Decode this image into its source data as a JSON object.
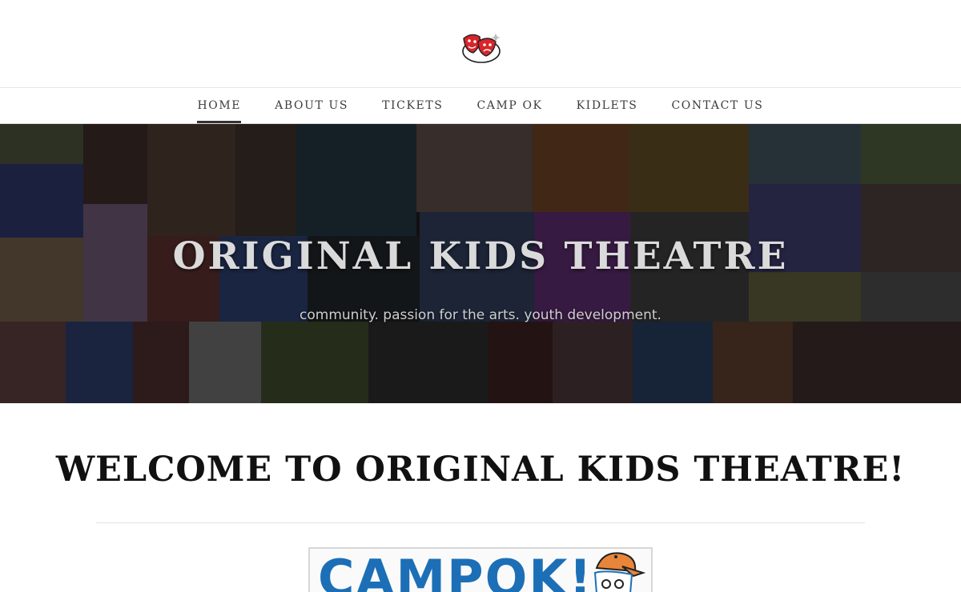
{
  "nav": {
    "items": [
      {
        "label": "HOME",
        "active": true
      },
      {
        "label": "ABOUT US",
        "active": false
      },
      {
        "label": "TICKETS",
        "active": false
      },
      {
        "label": "CAMP OK",
        "active": false
      },
      {
        "label": "KIDLETS",
        "active": false
      },
      {
        "label": "CONTACT US",
        "active": false
      }
    ]
  },
  "hero": {
    "title": "ORIGINAL KIDS THEATRE",
    "tagline": "community. passion for the arts. youth development."
  },
  "welcome": {
    "heading": "WELCOME TO ORIGINAL KIDS THEATRE!"
  },
  "camp_banner": {
    "text": "CAMPOK!"
  },
  "colors": {
    "logo_red": "#d9252a",
    "nav_text": "#3c3c3c",
    "camp_blue": "#1c6fb6",
    "camp_cap_orange": "#e9853a"
  },
  "icons": {
    "logo": "ok-theatre-masks-logo"
  }
}
